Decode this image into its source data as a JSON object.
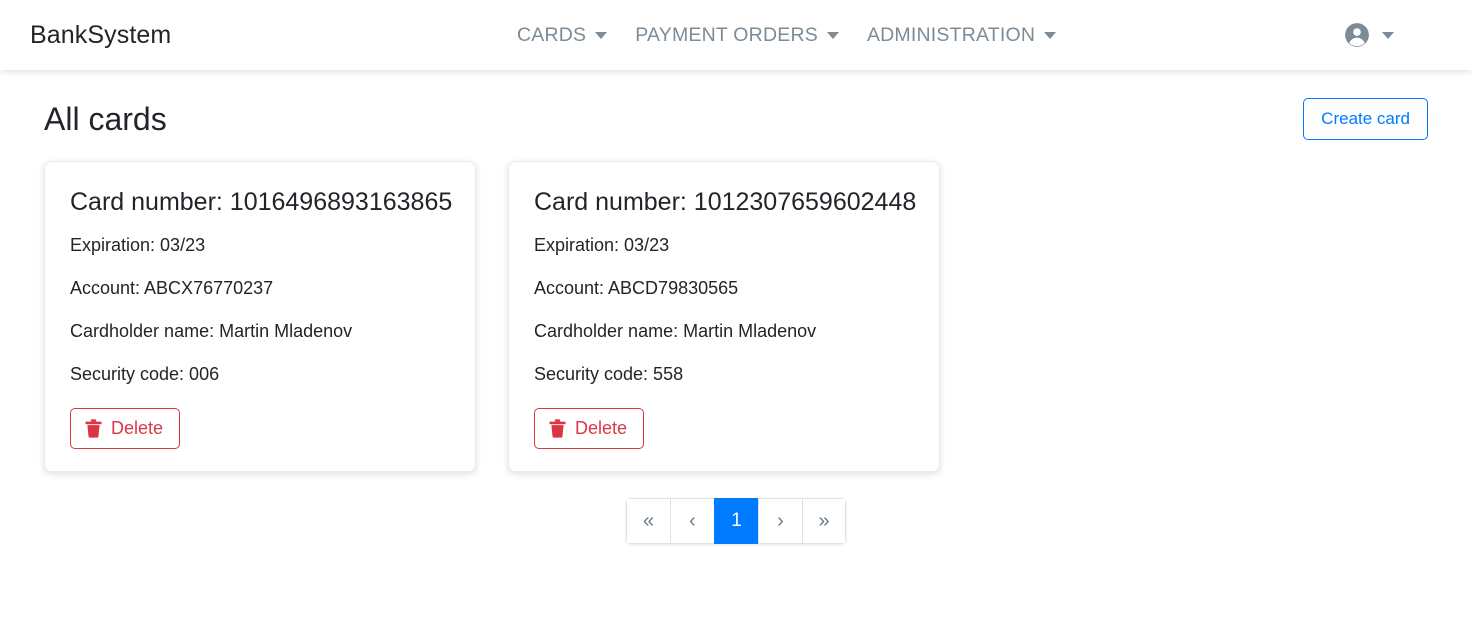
{
  "navbar": {
    "brand": "BankSystem",
    "menu": [
      {
        "label": "CARDS"
      },
      {
        "label": "PAYMENT ORDERS"
      },
      {
        "label": "ADMINISTRATION"
      }
    ],
    "account_icon": "account-circle-icon"
  },
  "page": {
    "title": "All cards",
    "create_button": "Create card"
  },
  "cards": [
    {
      "card_number": "Card number: 1016496893163865",
      "expiration": "Expiration: 03/23",
      "account": "Account: ABCX76770237",
      "cardholder": "Cardholder name: Martin Mladenov",
      "security_code": "Security code: 006",
      "delete_label": "Delete"
    },
    {
      "card_number": "Card number: 1012307659602448",
      "expiration": "Expiration: 03/23",
      "account": "Account: ABCD79830565",
      "cardholder": "Cardholder name: Martin Mladenov",
      "security_code": "Security code: 558",
      "delete_label": "Delete"
    }
  ],
  "pagination": {
    "first": "«",
    "prev": "‹",
    "pages": [
      "1"
    ],
    "next": "›",
    "last": "»",
    "current_page": "1"
  },
  "colors": {
    "primary": "#007bff",
    "danger": "#dc3545",
    "nav_text": "#7c8b96",
    "body_text": "#212529"
  }
}
